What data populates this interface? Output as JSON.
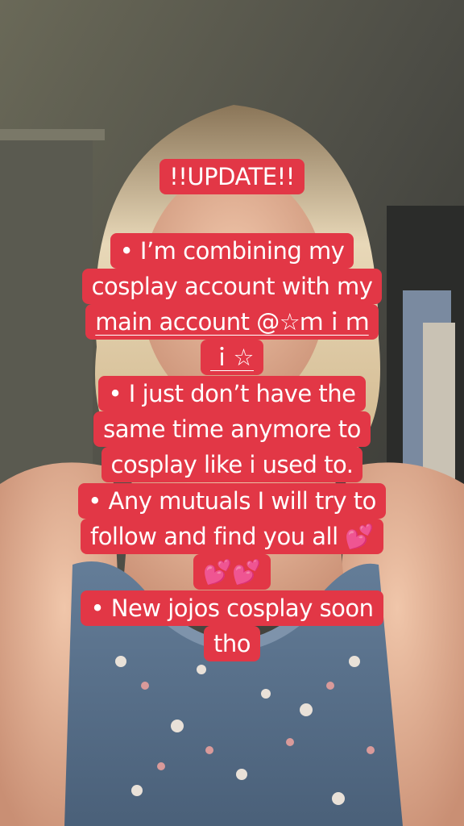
{
  "overlay": {
    "title": "!!UPDATE!!",
    "paragraphs": [
      [
        "• I’m combining my",
        "cosplay account with my",
        "main account @☆ｍｉｍ",
        "ｉ☆"
      ],
      [
        "• I just don’t have the",
        "same time anymore to",
        "cosplay like i used to."
      ],
      [
        "• Any mutuals I will try to",
        "follow and find you all 💕",
        "💕💕"
      ],
      [
        "• New jojos cosplay soon",
        "tho"
      ]
    ]
  },
  "colors": {
    "caption_bg": "#e23746",
    "caption_text": "#ffffff"
  }
}
